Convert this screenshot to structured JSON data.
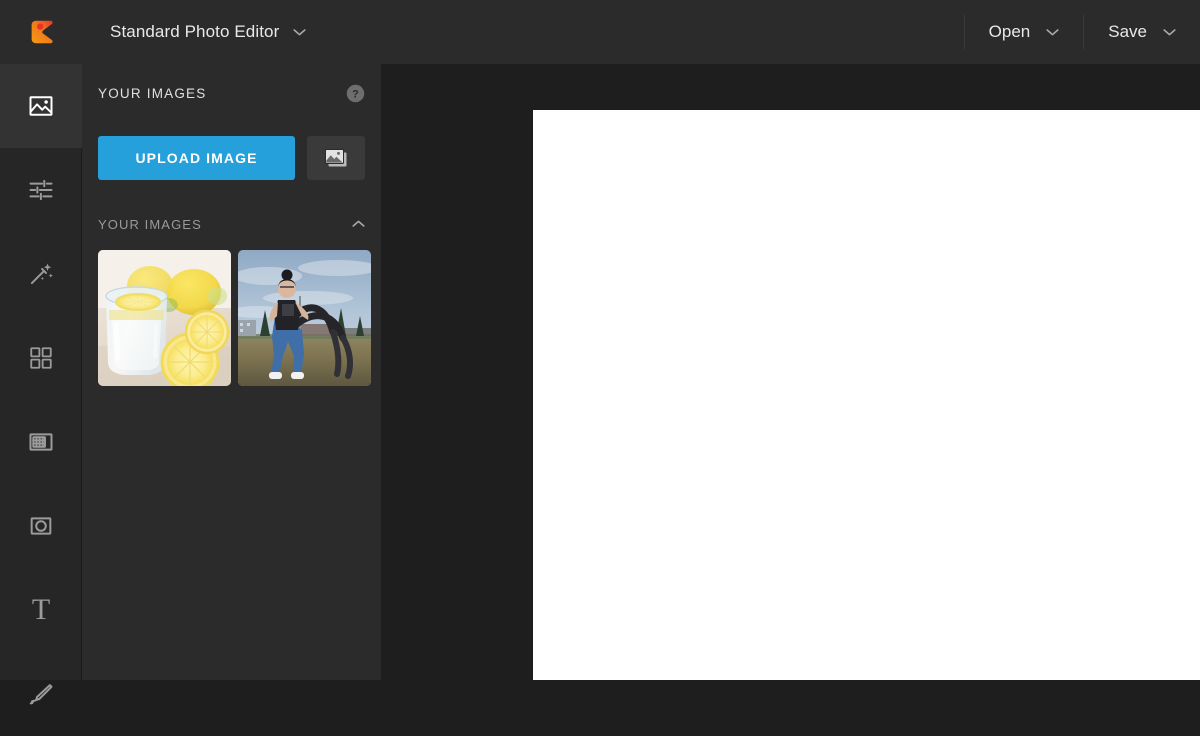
{
  "topbar": {
    "logo_icon": "pixlr-logo-icon",
    "app_title": "Standard Photo Editor",
    "app_title_chevron_icon": "chevron-down-icon",
    "open_label": "Open",
    "open_chevron_icon": "chevron-down-icon",
    "save_label": "Save",
    "save_chevron_icon": "chevron-down-icon",
    "background_color": "#2b2b2b"
  },
  "rail": {
    "background_color": "#262626",
    "active_background_color": "#333333",
    "tools": [
      {
        "name": "photo",
        "icon": "image-icon",
        "active": true
      },
      {
        "name": "adjust",
        "icon": "sliders-icon",
        "active": false
      },
      {
        "name": "effects",
        "icon": "magic-wand-icon",
        "active": false
      },
      {
        "name": "overlay",
        "icon": "grid-four-squares-icon",
        "active": false
      },
      {
        "name": "frame",
        "icon": "frame-icon",
        "active": false
      },
      {
        "name": "shape",
        "icon": "circle-in-square-icon",
        "active": false
      },
      {
        "name": "text",
        "icon": "text-t-icon",
        "active": false
      },
      {
        "name": "retouch",
        "icon": "pen-icon",
        "active": false
      }
    ]
  },
  "panel": {
    "background_color": "#2b2b2b",
    "header_title": "YOUR IMAGES",
    "help_icon": "help-circle-icon",
    "upload_button_label": "UPLOAD IMAGE",
    "upload_button_color": "#26a0da",
    "gallery_button_icon": "stacked-photos-icon",
    "section": {
      "label": "YOUR IMAGES",
      "chevron_icon": "chevron-up-icon",
      "expanded": true
    },
    "thumbnails": [
      {
        "name": "lemon-water-glass",
        "alt": "Glass of lemon water with lemons"
      },
      {
        "name": "battle-ropes-workout",
        "alt": "Woman exercising with battle ropes outdoors"
      }
    ]
  },
  "workspace": {
    "background_color": "#1e1e1e",
    "canvas_color": "#ffffff"
  }
}
